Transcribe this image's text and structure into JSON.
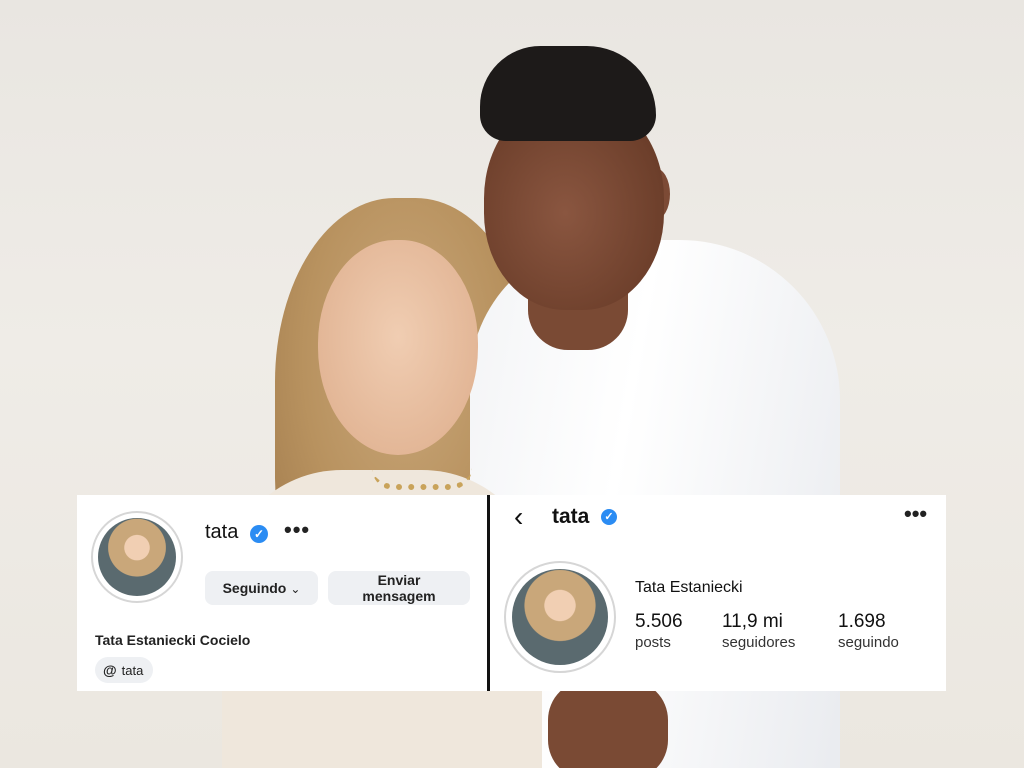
{
  "left_card": {
    "username": "tata",
    "following_button": "Seguindo",
    "message_button_line1": "Enviar",
    "message_button_line2": "mensagem",
    "full_name": "Tata Estaniecki Cocielo",
    "threads_handle": "tata"
  },
  "right_card": {
    "username": "tata",
    "full_name": "Tata Estaniecki",
    "stats": [
      {
        "value": "5.506",
        "label": "posts"
      },
      {
        "value": "11,9 mi",
        "label": "seguidores"
      },
      {
        "value": "1.698",
        "label": "seguindo"
      }
    ]
  },
  "icons": {
    "verified": "verified-badge-icon",
    "more": "more-options-icon",
    "back": "back-arrow-icon",
    "threads": "threads-icon",
    "chevron": "chevron-down-icon"
  },
  "colors": {
    "verified_blue": "#2b8cf3",
    "button_bg": "#eef0f3"
  }
}
